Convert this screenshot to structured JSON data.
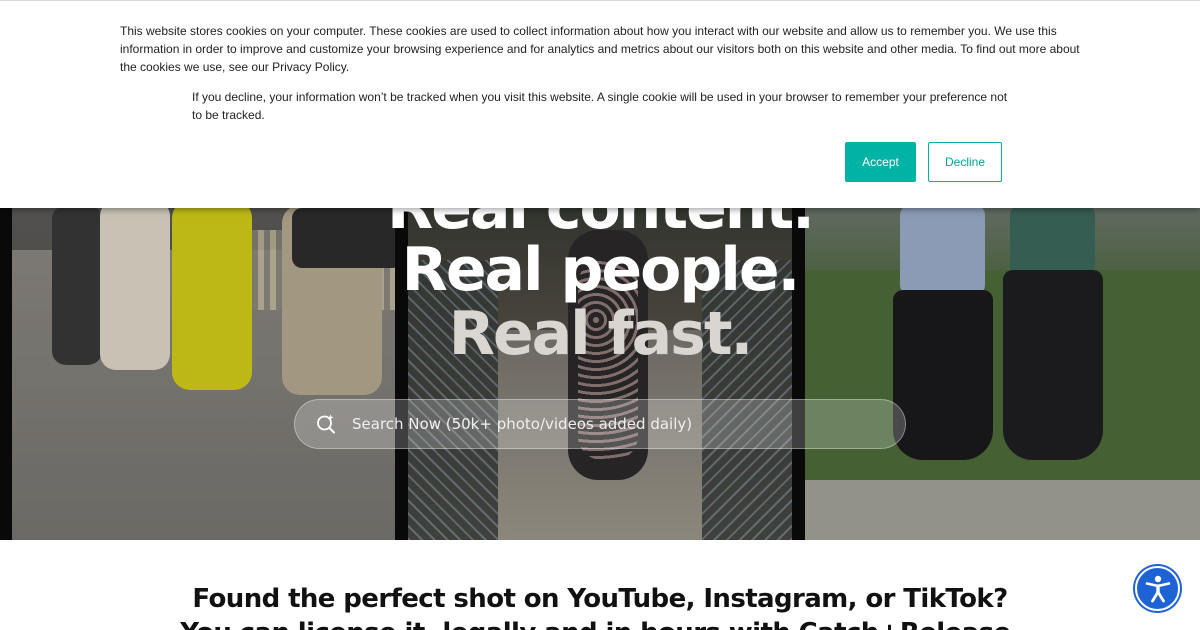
{
  "cookie_banner": {
    "paragraph_1": "This website stores cookies on your computer. These cookies are used to collect information about how you interact with our website and allow us to remember you. We use this information in order to improve and customize your browsing experience and for analytics and metrics about our visitors both on this website and other media. To find out more about the cookies we use, see our Privacy Policy.",
    "paragraph_2": "If you decline, your information won’t be tracked when you visit this website. A single cookie will be used in your browser to remember your preference not to be tracked.",
    "accept_label": "Accept",
    "decline_label": "Decline"
  },
  "hero": {
    "headline_line_1": "Real content.",
    "headline_line_2": "Real people.",
    "headline_line_3": "Real fast.",
    "search_placeholder": "Search Now (50k+ photo/videos added daily)",
    "search_icon": "search-sparkle-icon"
  },
  "below_hero": {
    "title_line_1": "Found the perfect shot on YouTube, Instagram, or TikTok?",
    "title_line_2": "You can license it, legally and in hours with Catch+Release."
  },
  "accessibility": {
    "icon": "accessibility-icon"
  },
  "colors": {
    "accent": "#00b3a4",
    "accessibility_blue": "#1e63d6",
    "text_dark": "#111111"
  }
}
